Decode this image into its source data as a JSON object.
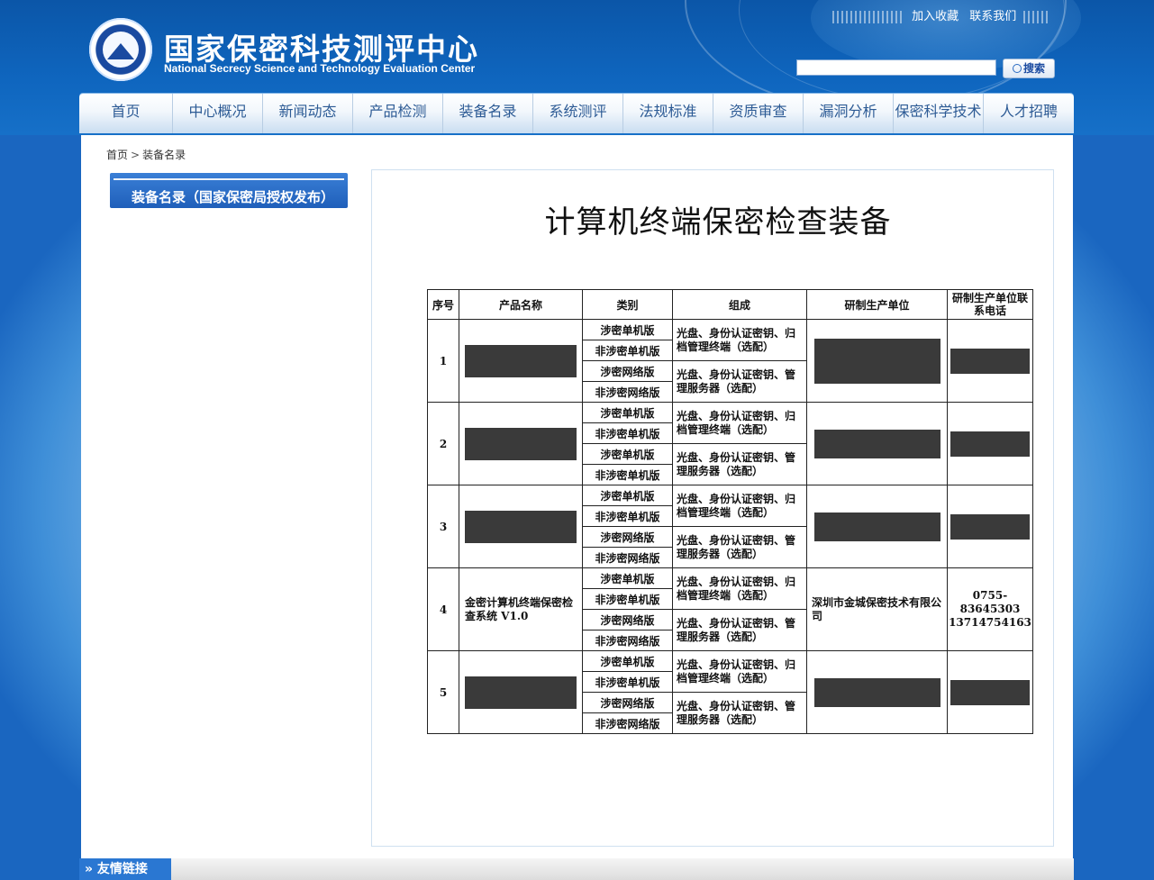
{
  "header": {
    "title_cn": "国家保密科技测评中心",
    "title_en": "National Secrecy Science and Technology Evaluation Center",
    "links": [
      "加入收藏",
      "联系我们"
    ],
    "search": {
      "value": "",
      "button_label": "搜索"
    },
    "logo_icon": "emblem-icon"
  },
  "nav": {
    "items": [
      "首页",
      "中心概况",
      "新闻动态",
      "产品检测",
      "装备名录",
      "系统测评",
      "法规标准",
      "资质审查",
      "漏洞分析",
      "保密科学技术",
      "人才招聘"
    ]
  },
  "breadcrumb": {
    "home": "首页",
    "sep": ">",
    "current": "装备名录"
  },
  "sidebar": {
    "title": "装备名录（国家保密局授权发布）"
  },
  "document": {
    "title": "计算机终端保密检查装备",
    "headers": {
      "seq": "序号",
      "name": "产品名称",
      "category": "类别",
      "composition": "组成",
      "maker": "研制生产单位",
      "phone": "研制生产单位联系电话"
    },
    "categories": [
      "涉密单机版",
      "非涉密单机版",
      "涉密网络版",
      "非涉密网络版"
    ],
    "compositions": [
      "光盘、身份认证密钥、归档管理终端（选配）",
      "光盘、身份认证密钥、管理服务器（选配）"
    ],
    "rows": [
      {
        "seq": "1",
        "name": "",
        "maker": "",
        "phone": "",
        "redacted": true
      },
      {
        "seq": "2",
        "name": "",
        "maker": "",
        "phone": "",
        "redacted": true
      },
      {
        "seq": "3",
        "name": "",
        "maker": "",
        "phone": "",
        "redacted": true
      },
      {
        "seq": "4",
        "name": "金密计算机终端保密检查系统 V1.0",
        "maker": "深圳市金城保密技术有限公司",
        "phone_1": "0755-83645303",
        "phone_2": "13714754163",
        "redacted": false
      },
      {
        "seq": "5",
        "name": "",
        "maker": "",
        "phone": "",
        "redacted": true
      }
    ]
  },
  "footer": {
    "friend_links_label": "友情链接"
  }
}
